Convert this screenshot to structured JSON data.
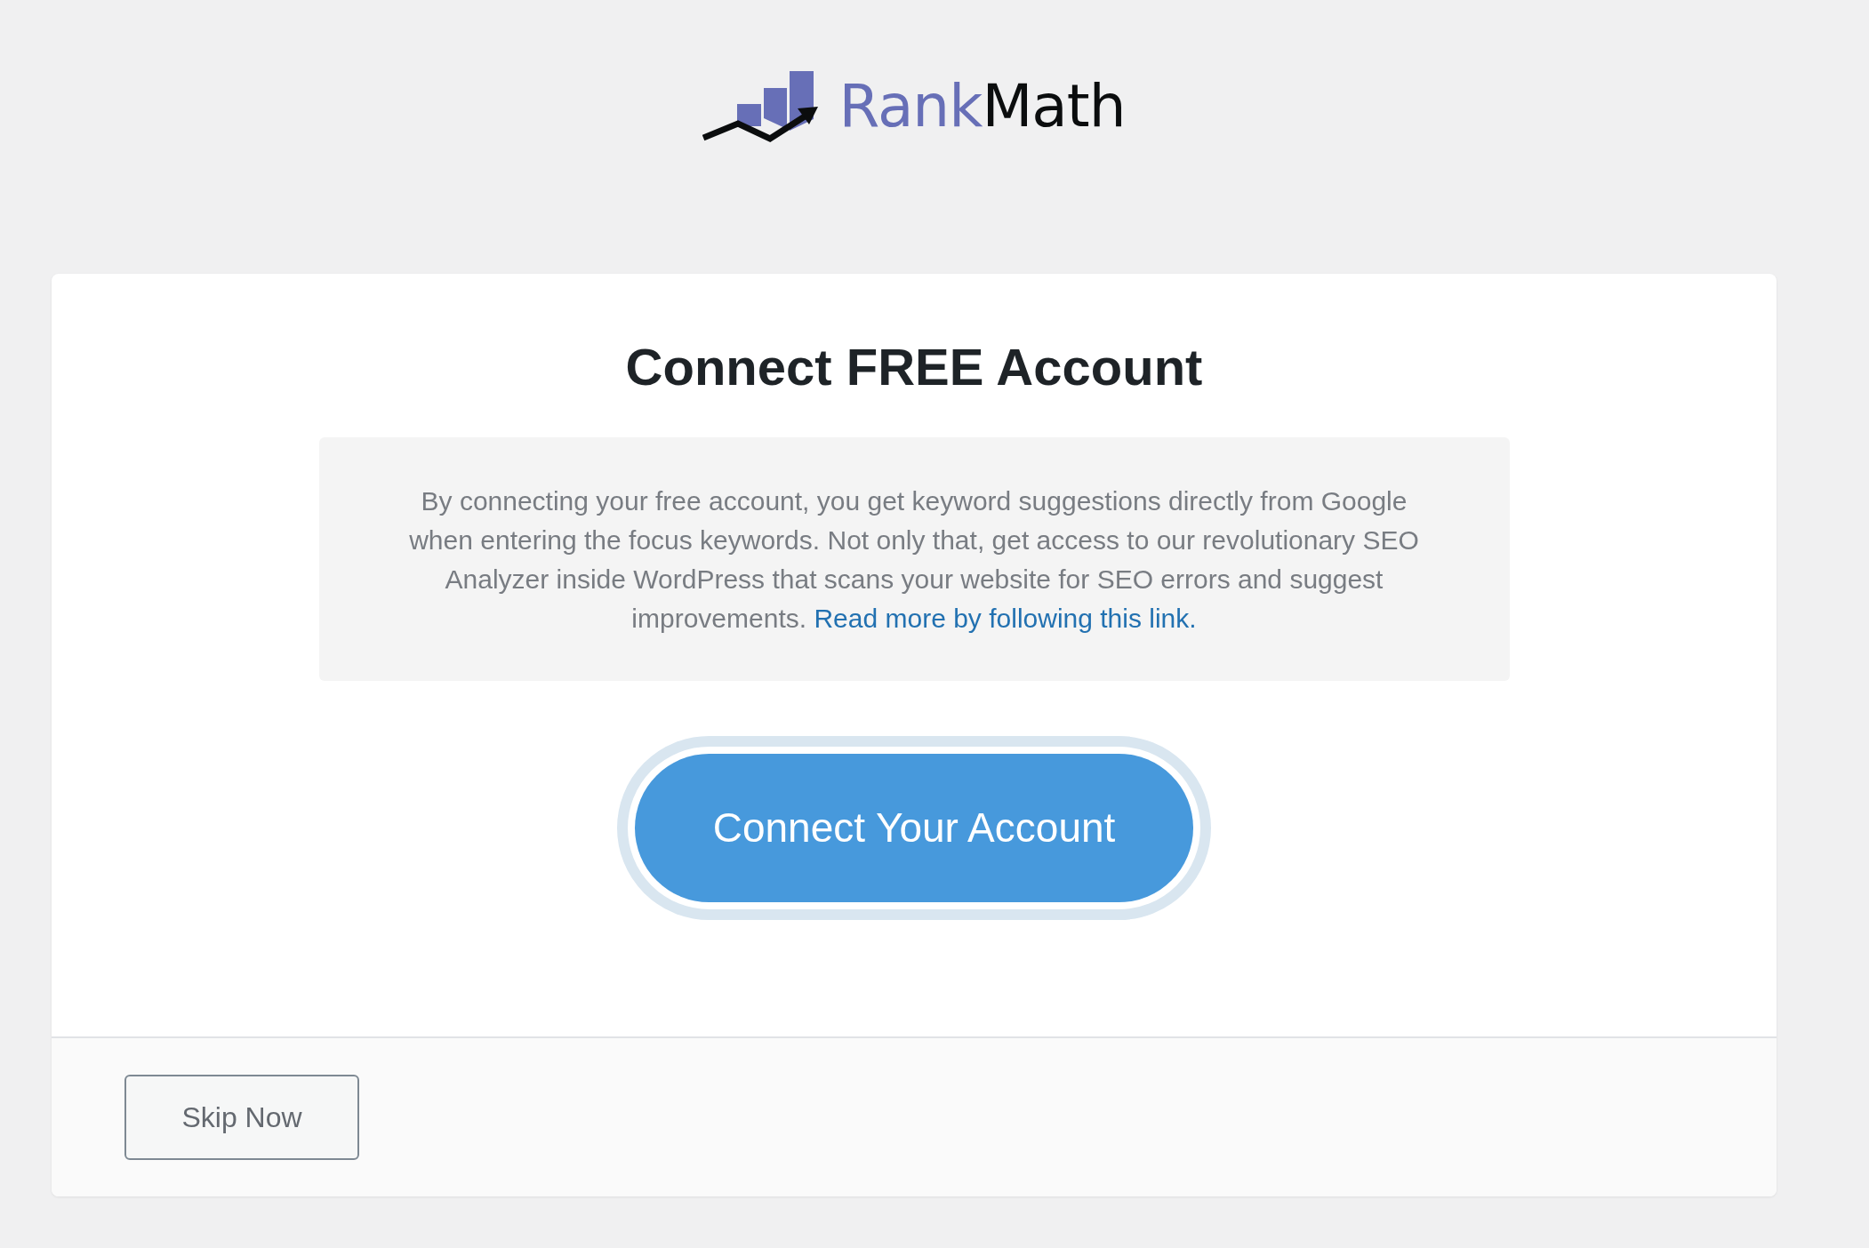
{
  "logo": {
    "parts": [
      "Rank",
      "Math"
    ]
  },
  "card": {
    "title": "Connect FREE Account",
    "description": "By connecting your free account, you get keyword suggestions directly from Google when entering the focus keywords. Not only that, get access to our revolutionary SEO Analyzer inside WordPress that scans your website for SEO errors and suggest improvements.",
    "link": "Read more by following this link.",
    "connect_button": "Connect Your Account"
  },
  "footer": {
    "skip_button": "Skip Now"
  }
}
